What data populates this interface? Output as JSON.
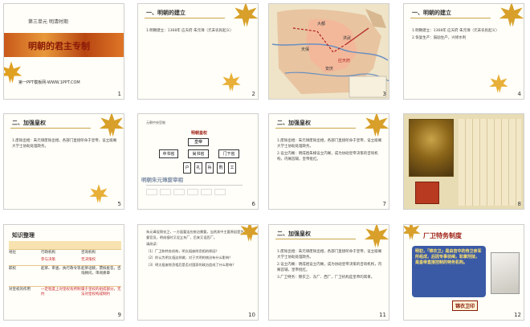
{
  "slides": [
    {
      "num": "1",
      "unit": "第三单元  明清时期",
      "title": "明朝的君主专制",
      "footer": "第一PPT模板网-WWW.1PPT.COM"
    },
    {
      "num": "2",
      "title": "一、明朝的建立",
      "lines": [
        "1.明朝建立：1368年 应天府 朱元璋（元末农民起义）"
      ]
    },
    {
      "num": "3",
      "map_labels": [
        "大都",
        "洪武",
        "天保",
        "应天府",
        "安庆"
      ]
    },
    {
      "num": "4",
      "title": "一、明朝的建立",
      "lines": [
        "1.明朝建立：1368年 应天府 朱元璋（元末农民起义）",
        "2.恢复生产：鼓励生产，兴修水利"
      ]
    },
    {
      "num": "5",
      "title": "二、加强皇权",
      "lines": [
        "1.废除丞相：朱元璋废除丞相，各部门直接听命于皇帝，设立殿阁大学士协助处理政务。"
      ]
    },
    {
      "num": "6",
      "chart_title": "元朝中央官制",
      "ming_title": "明朝皇权",
      "boxes": [
        "皇帝",
        "中书省",
        "尚书省",
        "门下省",
        "户",
        "礼",
        "兵",
        "刑",
        "工"
      ],
      "caption": "明朝朱元璋废宰相"
    },
    {
      "num": "7",
      "title": "二、加强皇权",
      "lines": [
        "1.废除丞相：朱元璋废除丞相，各部门直接听命于皇帝，设立殿阁大学士协助处理政务。",
        "2.设立内阁：明成祖朱棣设立内阁，成为协助皇帝决策的咨询机构，内阁首辅，皇帝批红。"
      ]
    },
    {
      "num": "8"
    },
    {
      "num": "9",
      "title": "知识整理",
      "rows": [
        [
          "地位",
          "行政机构",
          "咨询机构"
        ],
        [
          "",
          "参与决策",
          "无决策权"
        ],
        [
          "职权",
          "起草、审查、执行政令等",
          "起草诏敕，票拟批答，咨询顾问，审阅奏章"
        ],
        [
          "对皇权的作用",
          "一定程度上对皇权有所制约",
          "属于皇权的组成部分，无法对皇权构成制约"
        ]
      ]
    },
    {
      "num": "10",
      "lines": [
        "朱元璋设锦衣卫，一方面要适应统治需要，当然其中主要原因是为了监督官员。明成祖时又设立东厂，后来又设西厂。",
        "请阅读：",
        "（1）厂卫和特务机构，明太祖废除丞相的原因？",
        "（2）你认为明太祖这样做，对于大明的统治有什么影响？",
        "（3）明太祖废除丞相后是否对国家的政治造成了什么影响？"
      ]
    },
    {
      "num": "11",
      "title": "二、加强皇权",
      "lines": [
        "1.废除丞相：朱元璋废除丞相，各部门直接听命于皇帝，设立殿阁大学士协助处理政务。",
        "2.设立内阁：明成祖设立内阁，成为协助皇帝决策的咨询机构，内阁首辅，皇帝批红。",
        "3.厂卫特务：锦衣卫、东厂、西厂，厂卫机构是皇帝的耳目。"
      ]
    },
    {
      "num": "12",
      "title": "厂卫特务制度",
      "text": "明初，「锦衣卫」是由宫中的侍卫亲军所组成，后因专事侦缉，职掌刑狱，是皇帝直接控制的特务机构。",
      "stamp": "锦衣卫印"
    }
  ]
}
